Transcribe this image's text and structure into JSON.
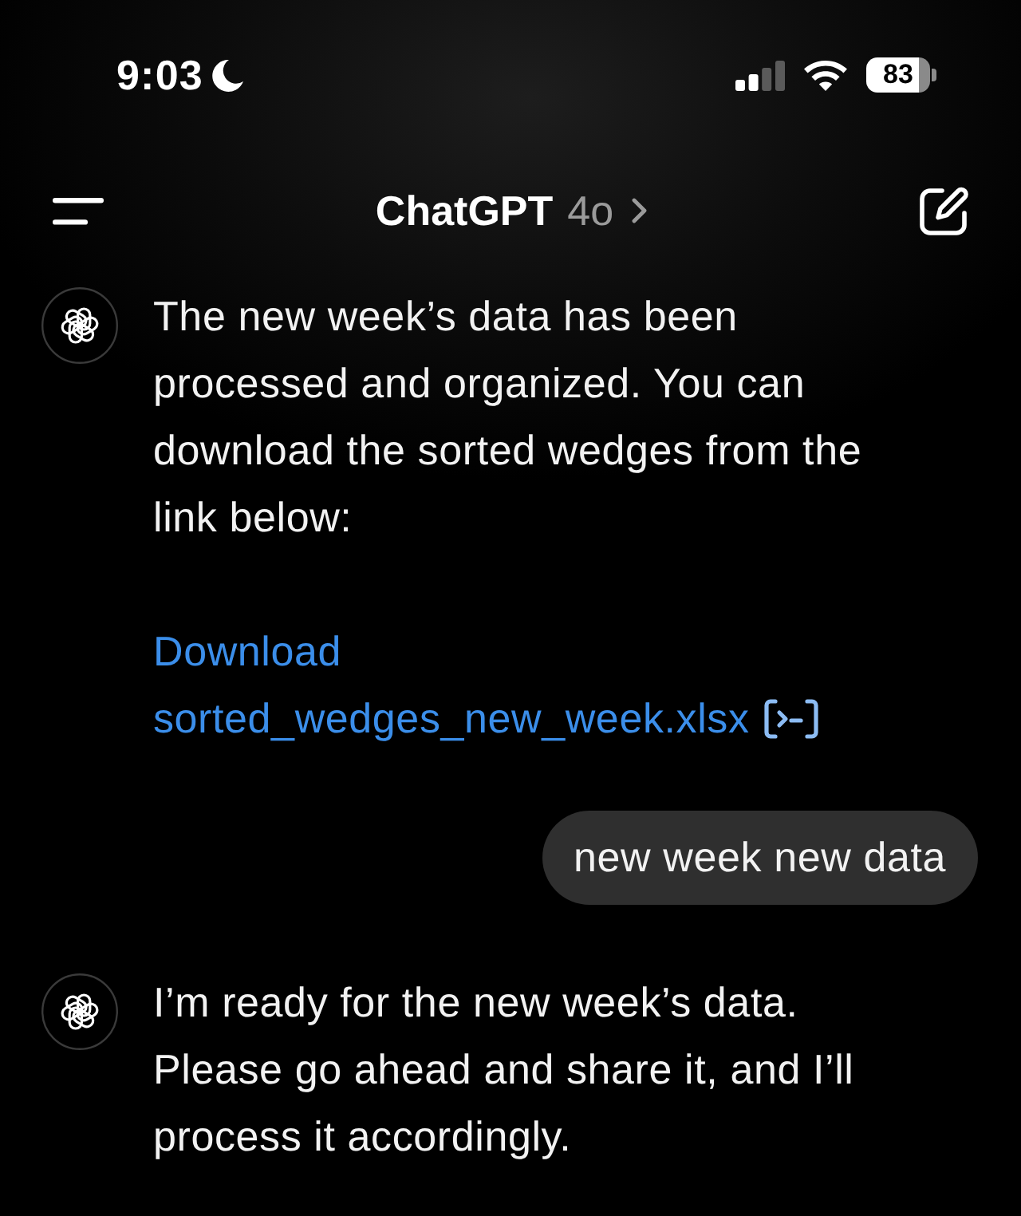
{
  "status_bar": {
    "time": "9:03",
    "battery": "83"
  },
  "nav": {
    "title": "ChatGPT",
    "model": "4o"
  },
  "messages": [
    {
      "kind": "assistant",
      "blocks": [
        {
          "kind": "text",
          "text": "The new week’s data has been processed and organized. You can download the sorted wedges from the link below:"
        },
        {
          "kind": "link",
          "text": "Download sorted_wedges_new_week.xlsx"
        }
      ]
    },
    {
      "kind": "user",
      "text": "new week new data"
    },
    {
      "kind": "assistant",
      "blocks": [
        {
          "kind": "text",
          "text": "I’m ready for the new week’s data. Please go ahead and share it, and I’ll process it accordingly."
        }
      ]
    }
  ]
}
